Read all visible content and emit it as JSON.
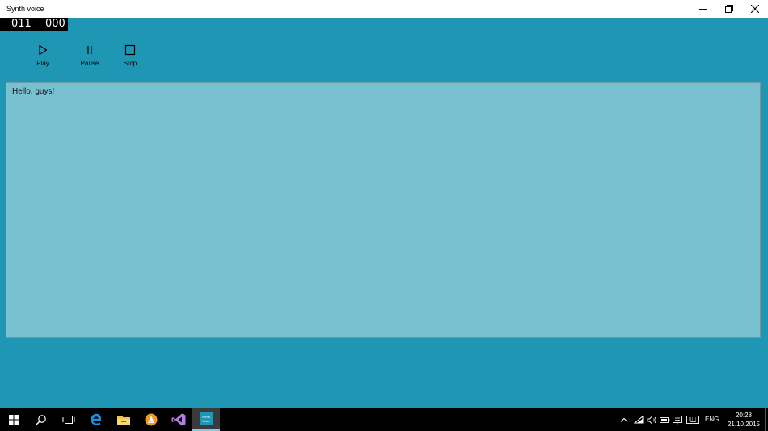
{
  "window": {
    "title": "Synth voice"
  },
  "counter": {
    "left_value": "011",
    "right_value": "000"
  },
  "commands": {
    "play_label": "Play",
    "pause_label": "Pause",
    "stop_label": "Stop"
  },
  "editor": {
    "text": "Hello, guys!"
  },
  "taskbar": {
    "active_app_line1": "Synth",
    "active_app_line2": "Voice",
    "language": "ENG",
    "time": "20:28",
    "date": "21.10.2015"
  },
  "colors": {
    "app_background": "#1f96b3",
    "editor_background": "#79c1d1",
    "taskbar_background": "#000000"
  },
  "icons": {
    "play": "play-icon",
    "pause": "pause-icon",
    "stop": "stop-icon",
    "minimize": "minimize-icon",
    "restore": "restore-icon",
    "close": "close-icon",
    "start": "windows-start-icon",
    "search": "search-icon",
    "task_view": "task-view-icon",
    "edge": "edge-icon",
    "explorer": "file-explorer-icon",
    "vlc": "vlc-icon",
    "visual_studio": "visual-studio-icon",
    "tray_chevron": "chevron-up-icon",
    "wifi": "wifi-icon",
    "volume": "volume-icon",
    "battery": "battery-icon",
    "notifications": "notification-icon",
    "keyboard": "keyboard-icon"
  }
}
